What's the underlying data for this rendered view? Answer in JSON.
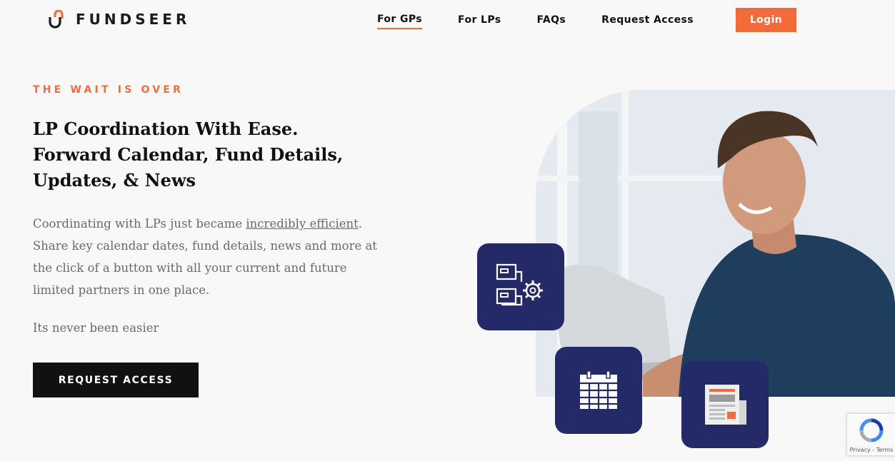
{
  "brand": {
    "name": "FUNDSEER",
    "accent_color": "#f26b3a",
    "navy_color": "#232a67"
  },
  "nav": {
    "items": [
      {
        "label": "For GPs",
        "active": true
      },
      {
        "label": "For LPs",
        "active": false
      },
      {
        "label": "FAQs",
        "active": false
      },
      {
        "label": "Request Access",
        "active": false
      }
    ],
    "login_label": "Login"
  },
  "hero": {
    "eyebrow": "THE WAIT IS OVER",
    "headline_lines": [
      "LP Coordination With Ease.",
      "Forward Calendar, Fund Details,",
      "Updates, & News"
    ],
    "body_before_link": "Coordinating with LPs just became ",
    "body_link": "incredibly efficient",
    "body_after_link": ". Share key calendar dates, fund details, news and more at the click of a button with all your current and future limited partners in one place.",
    "tagline": "Its never been easier",
    "cta_label": "REQUEST ACCESS"
  },
  "feature_icons": [
    "data-settings-icon",
    "calendar-icon",
    "newspaper-icon"
  ],
  "recaptcha": {
    "links": "Privacy - Terms"
  }
}
